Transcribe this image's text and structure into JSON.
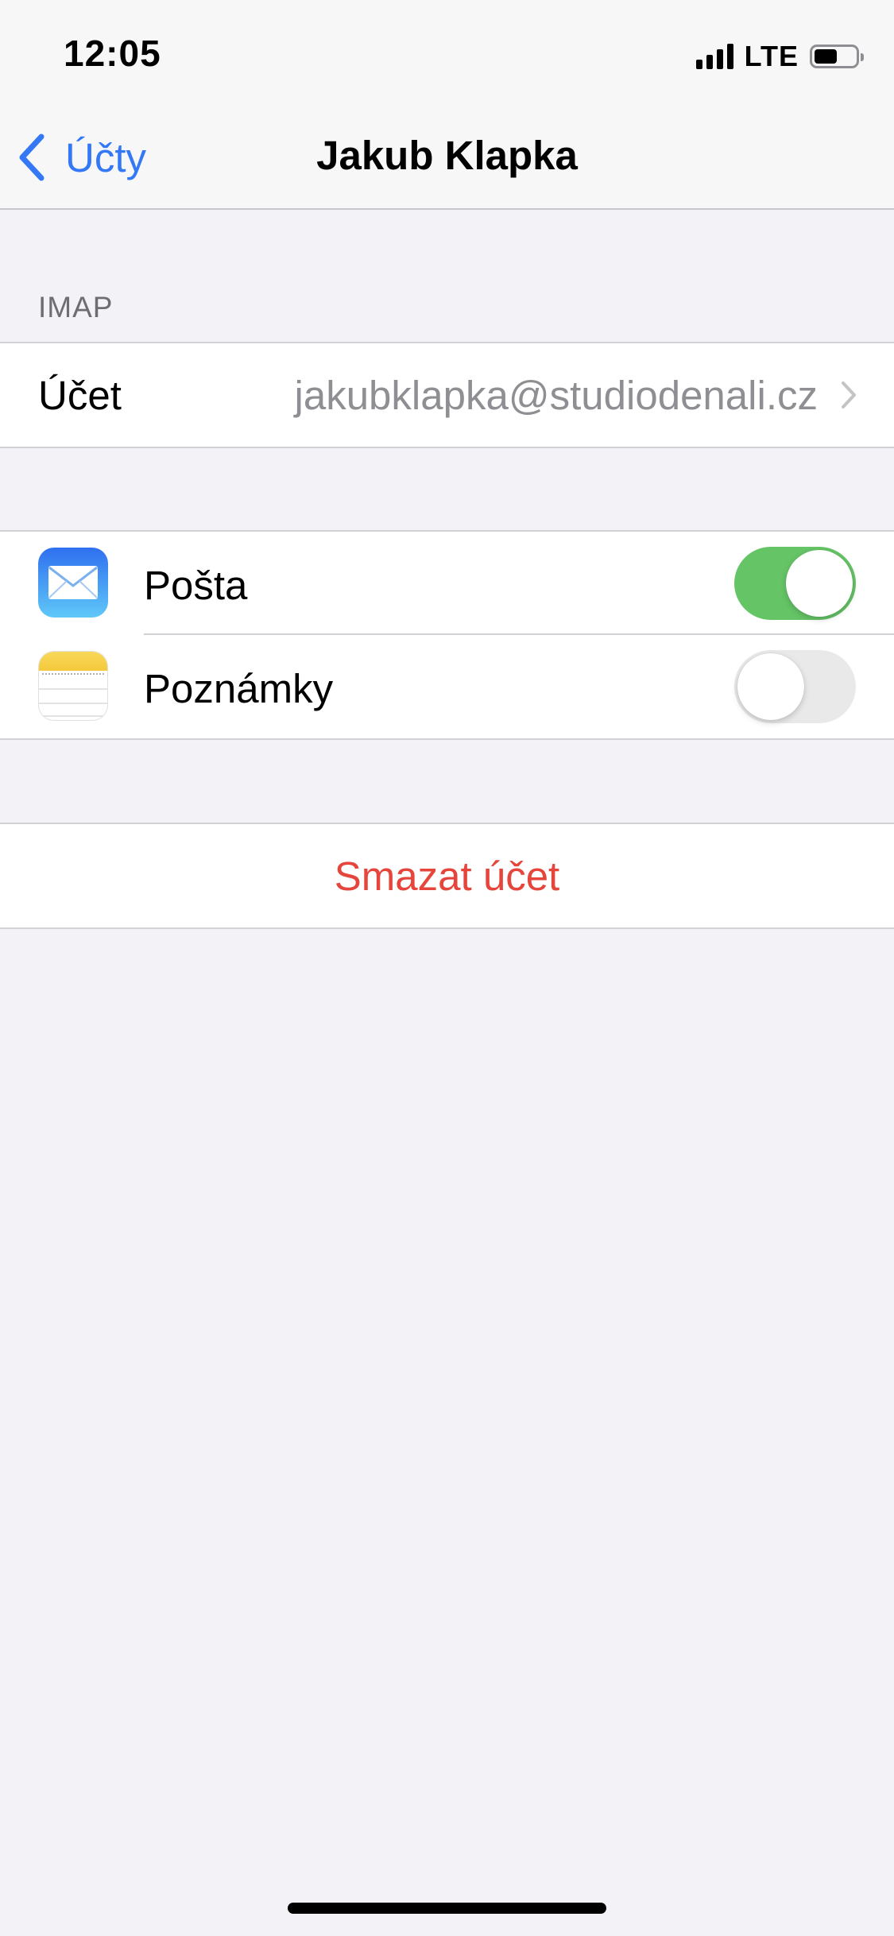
{
  "status_bar": {
    "time": "12:05",
    "network": "LTE",
    "signal_bars": 4,
    "battery_level": 0.55
  },
  "nav": {
    "back_label": "Účty",
    "title": "Jakub Klapka"
  },
  "account_section": {
    "header": "IMAP",
    "row_label": "Účet",
    "row_value": "jakubklapka@studiodenali.cz"
  },
  "apps": [
    {
      "label": "Pošta",
      "icon": "mail-icon",
      "enabled": true
    },
    {
      "label": "Poznámky",
      "icon": "notes-icon",
      "enabled": false
    }
  ],
  "delete_label": "Smazat účet",
  "colors": {
    "accent": "#3478f6",
    "toggle_on": "#65c466",
    "destructive": "#e5453b",
    "background": "#f2f2f7"
  }
}
